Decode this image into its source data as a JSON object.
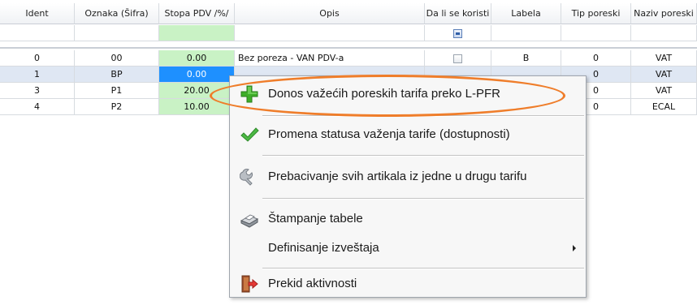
{
  "table": {
    "columns": [
      "Ident",
      "Oznaka (Šifra)",
      "Stopa PDV /%/",
      "Opis",
      "Da li se koristi",
      "Labela",
      "Tip poreski",
      "Naziv poreski"
    ],
    "rows": [
      {
        "ident": "0",
        "oznaka": "00",
        "stopa": "0.00",
        "opis": "Bez poreza - VAN PDV-a",
        "labela": "B",
        "tip": "0",
        "naziv": "VAT"
      },
      {
        "ident": "1",
        "oznaka": "BP",
        "stopa": "0.00",
        "opis": "",
        "labela": "",
        "tip": "0",
        "naziv": "VAT"
      },
      {
        "ident": "3",
        "oznaka": "P1",
        "stopa": "20.00",
        "opis": "",
        "labela": "",
        "tip": "0",
        "naziv": "VAT"
      },
      {
        "ident": "4",
        "oznaka": "P2",
        "stopa": "10.00",
        "opis": "",
        "labela": "",
        "tip": "0",
        "naziv": "ECAL"
      }
    ]
  },
  "context_menu": {
    "items": [
      {
        "label": "Donos važećih poreskih tarifa preko L-PFR",
        "icon": "plus-icon"
      },
      {
        "label": "Promena statusa važenja tarife (dostupnosti)",
        "icon": "checkmark-icon"
      },
      {
        "label": "Prebacivanje svih artikala iz jedne u drugu tarifu",
        "icon": "wrench-icon"
      },
      {
        "label": "Štampanje tabele",
        "icon": "printer-icon"
      },
      {
        "label": "Definisanje izveštaja",
        "icon": "",
        "submenu": true
      },
      {
        "label": "Prekid aktivnosti",
        "icon": "exit-door-icon"
      }
    ]
  },
  "colors": {
    "accent_highlight": "#ef7d2a",
    "selected_cell": "#1e90ff",
    "rate_column": "#c9f2c5"
  }
}
